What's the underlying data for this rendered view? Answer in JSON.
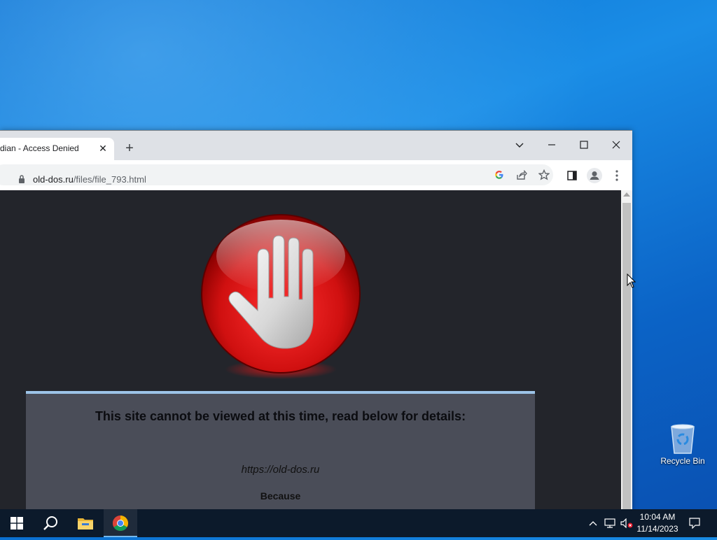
{
  "browser": {
    "tab_title": "dian - Access Denied",
    "tab_close": "✕",
    "new_tab": "+",
    "window_controls": {
      "dropdown": "⌄",
      "minimize": "—",
      "maximize": "☐",
      "close": "✕"
    },
    "url_host": "old-dos.ru",
    "url_path": "/files/file_793.html",
    "toolbar_icons": [
      "google-icon",
      "share-icon",
      "bookmark-star-icon",
      "side-panel-icon",
      "profile-icon",
      "menu-icon"
    ]
  },
  "page": {
    "heading": "This site cannot be viewed at this time, read below for details:",
    "blocked_url": "https://old-dos.ru",
    "because": "Because",
    "accent_color": "#9dc4e8"
  },
  "desktop": {
    "recycle_bin_label": "Recycle Bin"
  },
  "taskbar": {
    "time": "10:04 AM",
    "date": "11/14/2023",
    "apps": [
      "start-icon",
      "search-icon",
      "file-explorer-icon",
      "chrome-icon"
    ]
  }
}
